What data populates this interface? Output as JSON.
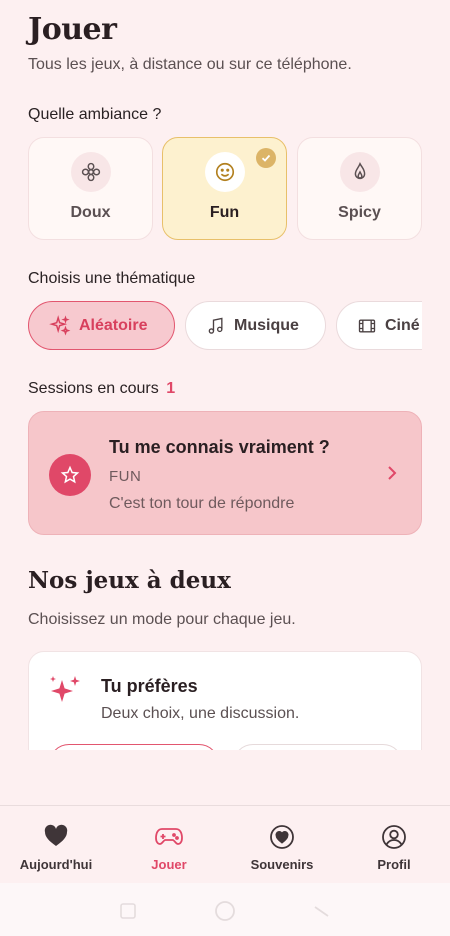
{
  "header": {
    "title": "Jouer",
    "subtitle": "Tous les jeux, à distance ou sur ce téléphone."
  },
  "mood": {
    "label": "Quelle ambiance ?",
    "options": [
      {
        "label": "Doux",
        "icon": "flower-icon",
        "selected": false
      },
      {
        "label": "Fun",
        "icon": "smile-icon",
        "selected": true
      },
      {
        "label": "Spicy",
        "icon": "flame-icon",
        "selected": false
      }
    ]
  },
  "theme": {
    "label": "Choisis une thématique",
    "chips": [
      {
        "label": "Aléatoire",
        "icon": "sparkles-icon",
        "active": true
      },
      {
        "label": "Musique",
        "icon": "music-note-icon",
        "active": false
      },
      {
        "label": "Ciné",
        "icon": "film-icon",
        "active": false
      }
    ]
  },
  "sessions": {
    "label": "Sessions en cours",
    "count": "1",
    "items": [
      {
        "title": "Tu me connais vraiment ?",
        "mood": "FUN",
        "status": "C'est ton tour de répondre"
      }
    ]
  },
  "games": {
    "title": "Nos jeux à deux",
    "subtitle": "Choisissez un mode pour chaque jeu.",
    "items": [
      {
        "title": "Tu préfères",
        "description": "Deux choix, une discussion."
      }
    ]
  },
  "nav": {
    "items": [
      {
        "label": "Aujourd'hui",
        "icon": "heart-icon",
        "active": false
      },
      {
        "label": "Jouer",
        "icon": "gamepad-icon",
        "active": true
      },
      {
        "label": "Souvenirs",
        "icon": "heart-circle-icon",
        "active": false
      },
      {
        "label": "Profil",
        "icon": "user-circle-icon",
        "active": false
      }
    ]
  },
  "colors": {
    "background": "#fdf0f1",
    "accent": "#e04868",
    "selected_mood": "#fdf1cf",
    "session_card": "#f6c6ca"
  }
}
